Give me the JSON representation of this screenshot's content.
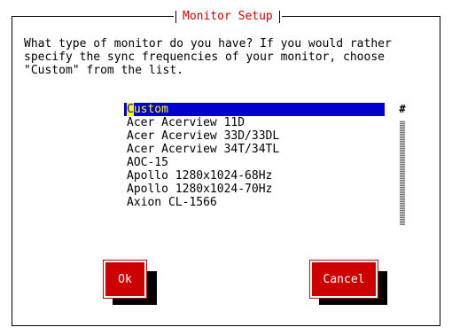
{
  "dialog": {
    "title": "Monitor Setup",
    "prompt": "What type of monitor do you have? If you would rather\nspecify the sync frequencies of your monitor, choose\n\"Custom\" from the list."
  },
  "monitor_list": {
    "items": [
      "Custom",
      "Acer Acerview 11D",
      "Acer Acerview 33D/33DL",
      "Acer Acerview 34T/34TL",
      "AOC-15",
      "Apollo 1280x1024-68Hz",
      "Apollo 1280x1024-70Hz",
      "Axion CL-1566"
    ],
    "selected_index": 0,
    "selected_first_char": "C",
    "selected_rest": "ustom",
    "scroll_thumb_glyph": "#"
  },
  "buttons": {
    "ok_label": "Ok",
    "cancel_label": "Cancel"
  },
  "colors": {
    "title": "#cc0000",
    "button_bg": "#cc0000",
    "selection_bg": "#0000c8",
    "selection_fg": "#ffff00"
  }
}
